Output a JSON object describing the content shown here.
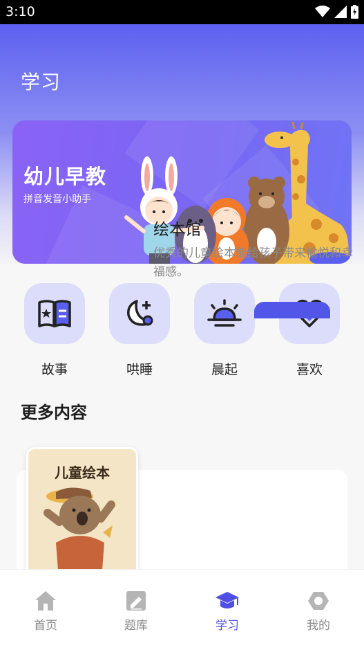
{
  "status_bar": {
    "time": "3:10"
  },
  "header": {
    "title": "学习"
  },
  "banner": {
    "title": "幼儿早教",
    "subtitle": "拼音发音小助手"
  },
  "shortcuts": [
    {
      "label": "故事",
      "icon": "storybook-icon"
    },
    {
      "label": "哄睡",
      "icon": "moon-icon"
    },
    {
      "label": "晨起",
      "icon": "sunrise-icon"
    },
    {
      "label": "喜欢",
      "icon": "heart-icon"
    }
  ],
  "more": {
    "title": "更多内容",
    "card": {
      "book_title": "儿童绘本",
      "title": "绘本馆",
      "description": "优秀的儿童绘本能给孩子带来愉悦和幸福感。"
    }
  },
  "tabbar": {
    "items": [
      {
        "label": "首页",
        "icon": "home-icon"
      },
      {
        "label": "题库",
        "icon": "edit-icon"
      },
      {
        "label": "学习",
        "icon": "graduation-cap-icon",
        "active": true
      },
      {
        "label": "我的",
        "icon": "profile-hexagon-icon"
      }
    ]
  },
  "colors": {
    "accent": "#4f4fe6",
    "icon_bg": "#dcddfb",
    "icon_fg": "#4f4fe6",
    "tab_inactive": "#b5b5b5"
  }
}
